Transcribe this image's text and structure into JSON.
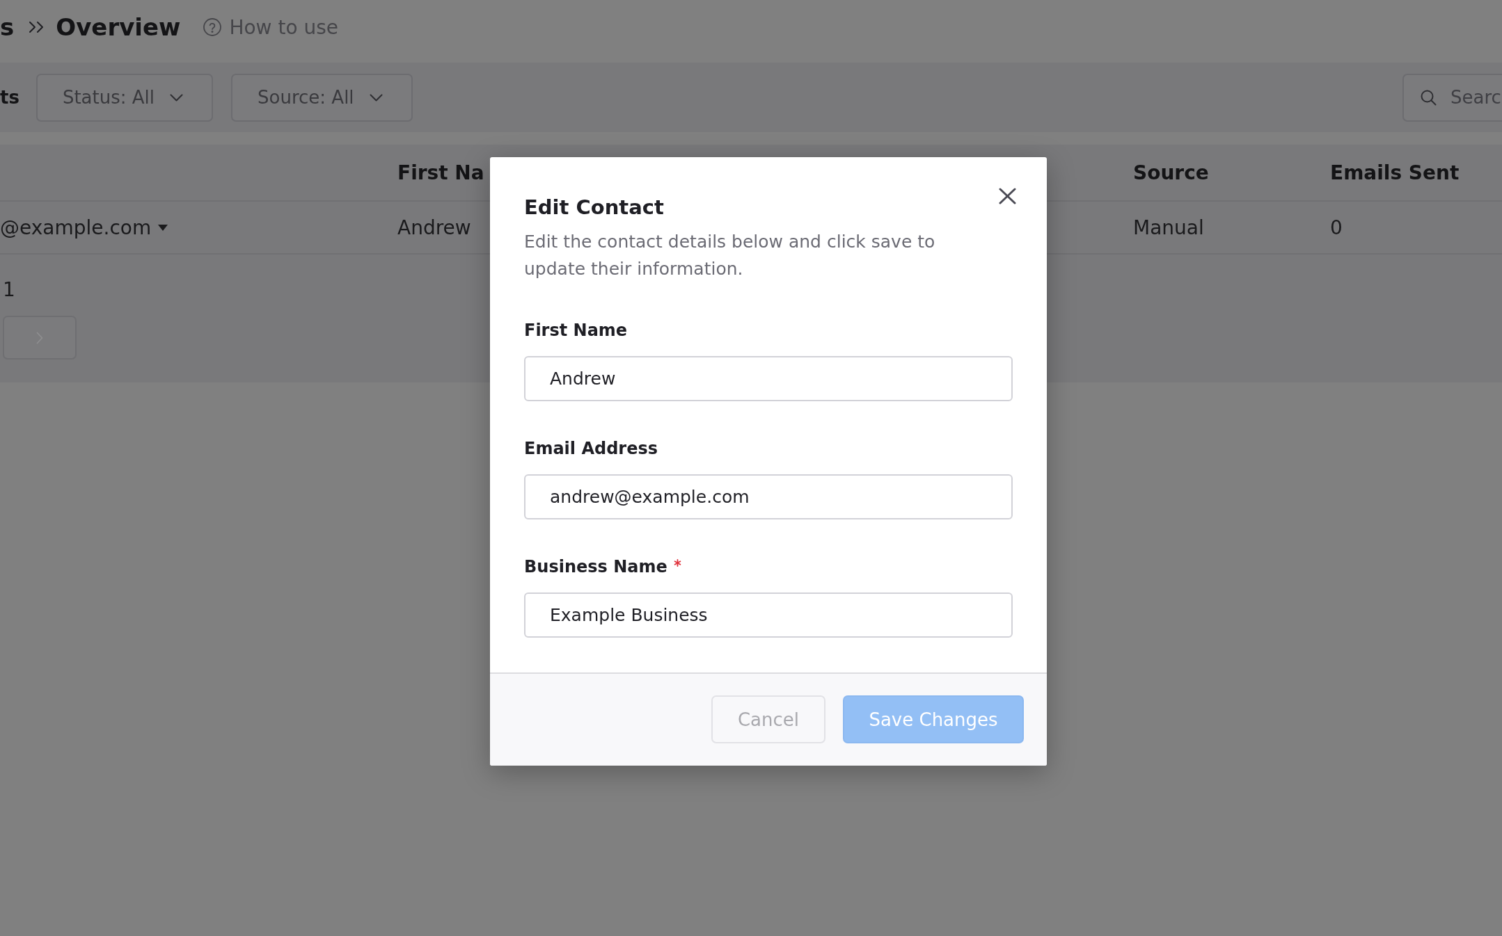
{
  "breadcrumb": {
    "parent": "s",
    "current": "Overview"
  },
  "help_link": {
    "label": "How to use"
  },
  "toolbar": {
    "title": "ts",
    "filters": [
      {
        "label": "Status: All"
      },
      {
        "label": "Source: All"
      }
    ],
    "search": {
      "placeholder": "Searc"
    }
  },
  "table": {
    "columns": [
      {
        "label": "First Na"
      },
      {
        "label": "Source"
      },
      {
        "label": "Emails Sent"
      }
    ],
    "rows": [
      {
        "email": "@example.com",
        "cells": [
          "Andrew",
          "Manual",
          "0"
        ]
      }
    ]
  },
  "pagination": {
    "page": "1",
    "next_button": {
      "disabled": true
    }
  },
  "modal": {
    "title": "Edit Contact",
    "description": "Edit the contact details below and click save to update their information.",
    "fields": [
      {
        "label": "First Name",
        "value": "Andrew",
        "required": false
      },
      {
        "label": "Email Address",
        "value": "andrew@example.com",
        "required": false
      },
      {
        "label": "Business Name",
        "value": "Example Business",
        "required": true
      }
    ],
    "buttons": [
      {
        "label": "Cancel",
        "kind": "secondary",
        "disabled": true
      },
      {
        "label": "Save Changes",
        "kind": "primary",
        "disabled": true
      }
    ]
  }
}
